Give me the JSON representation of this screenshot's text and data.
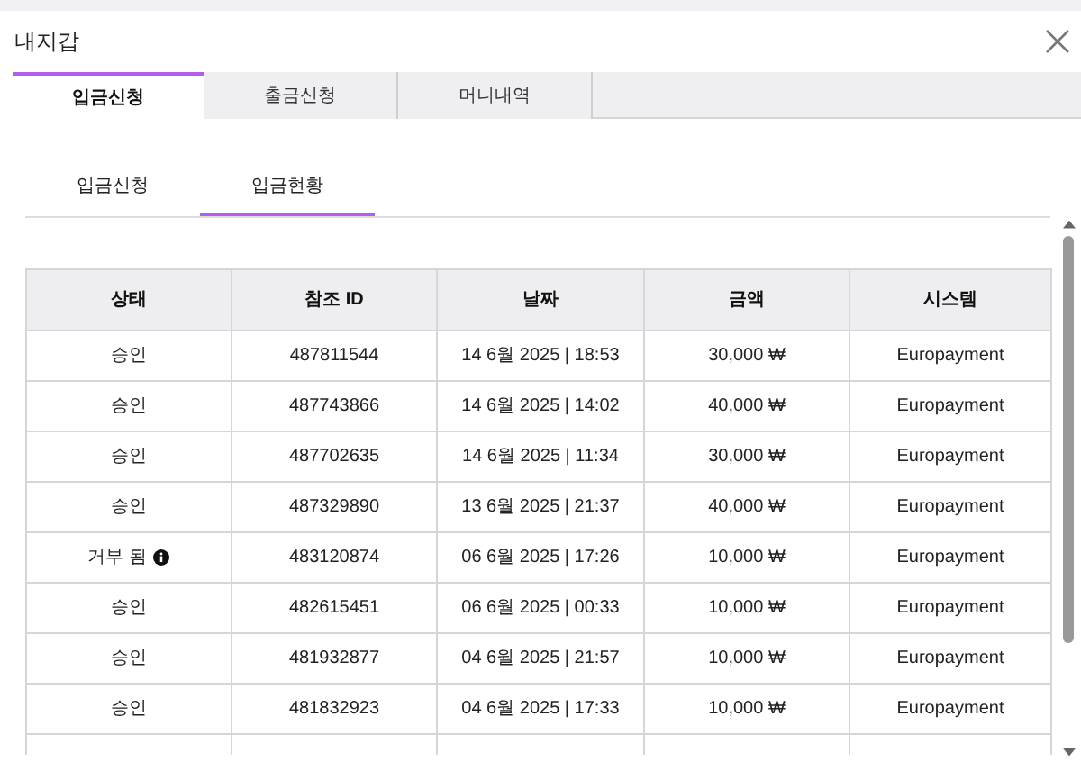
{
  "window": {
    "title": "내지갑"
  },
  "tabs": [
    {
      "label": "입금신청",
      "selected": true
    },
    {
      "label": "출금신청",
      "selected": false
    },
    {
      "label": "머니내역",
      "selected": false
    }
  ],
  "subtabs": [
    {
      "label": "입금신청",
      "selected": false
    },
    {
      "label": "입금현황",
      "selected": true
    }
  ],
  "table": {
    "columns": [
      "상태",
      "참조 ID",
      "날짜",
      "금액",
      "시스템"
    ],
    "rows": [
      {
        "status": "승인",
        "info": false,
        "id": "487811544",
        "date": "14 6월 2025 | 18:53",
        "amount": "30,000 ₩",
        "system": "Europayment"
      },
      {
        "status": "승인",
        "info": false,
        "id": "487743866",
        "date": "14 6월 2025 | 14:02",
        "amount": "40,000 ₩",
        "system": "Europayment"
      },
      {
        "status": "승인",
        "info": false,
        "id": "487702635",
        "date": "14 6월 2025 | 11:34",
        "amount": "30,000 ₩",
        "system": "Europayment"
      },
      {
        "status": "승인",
        "info": false,
        "id": "487329890",
        "date": "13 6월 2025 | 21:37",
        "amount": "40,000 ₩",
        "system": "Europayment"
      },
      {
        "status": "거부 됨",
        "info": true,
        "id": "483120874",
        "date": "06 6월 2025 | 17:26",
        "amount": "10,000 ₩",
        "system": "Europayment"
      },
      {
        "status": "승인",
        "info": false,
        "id": "482615451",
        "date": "06 6월 2025 | 00:33",
        "amount": "10,000 ₩",
        "system": "Europayment"
      },
      {
        "status": "승인",
        "info": false,
        "id": "481932877",
        "date": "04 6월 2025 | 21:57",
        "amount": "10,000 ₩",
        "system": "Europayment"
      },
      {
        "status": "승인",
        "info": false,
        "id": "481832923",
        "date": "04 6월 2025 | 17:33",
        "amount": "10,000 ₩",
        "system": "Europayment"
      }
    ]
  }
}
